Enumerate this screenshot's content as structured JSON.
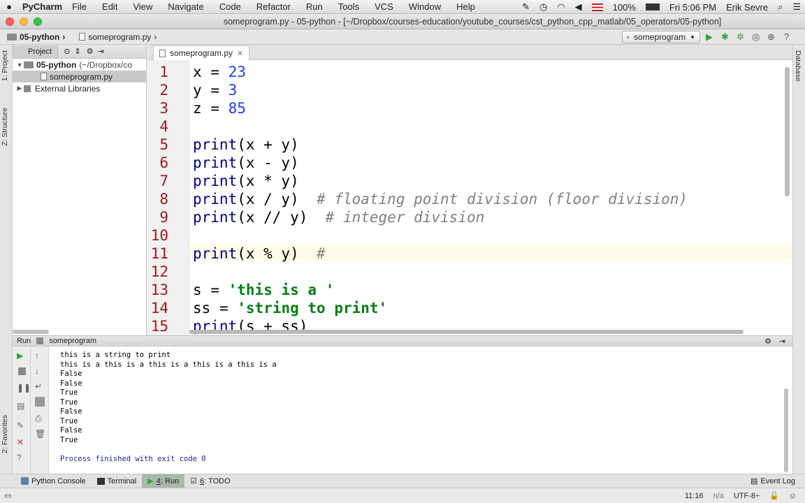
{
  "menubar": {
    "app_name": "PyCharm",
    "items": [
      "File",
      "Edit",
      "View",
      "Navigate",
      "Code",
      "Refactor",
      "Run",
      "Tools",
      "VCS",
      "Window",
      "Help"
    ],
    "battery": "100%",
    "clock": "Fri 5:06 PM",
    "user": "Erik Sevre"
  },
  "window": {
    "title": "someprogram.py - 05-python - [~/Dropbox/courses-education/youtube_courses/cst_python_cpp_matlab/05_operators/05-python]"
  },
  "navbar": {
    "crumbs": [
      "05-python",
      "someprogram.py"
    ],
    "run_config": "someprogram"
  },
  "left_strip": {
    "project_tab": "1: Project",
    "structure_tab": "Z: Structure",
    "favorites_tab": "2: Favorites"
  },
  "right_strip": {
    "database_tab": "Database"
  },
  "project_panel": {
    "header": "Project",
    "root": "05-python",
    "root_path": "(~/Dropbox/co",
    "file": "someprogram.py",
    "libraries": "External Libraries"
  },
  "editor": {
    "tab_label": "someprogram.py",
    "lines": [
      {
        "n": "1",
        "html": "<span class='id'>x</span> <span class='op'>=</span> <span class='num'>23</span>"
      },
      {
        "n": "2",
        "html": "<span class='id'>y</span> <span class='op'>=</span> <span class='num'>3</span>"
      },
      {
        "n": "3",
        "html": "<span class='id'>z</span> <span class='op'>=</span> <span class='num'>85</span>"
      },
      {
        "n": "4",
        "html": ""
      },
      {
        "n": "5",
        "html": "print<span class='op'>(x + y)</span>"
      },
      {
        "n": "6",
        "html": "print<span class='op'>(x - y)</span>"
      },
      {
        "n": "7",
        "html": "print<span class='op'>(x * y)</span>"
      },
      {
        "n": "8",
        "html": "print<span class='op'>(x / y)</span>  <span class='cm'># floating point division (floor division)</span>"
      },
      {
        "n": "9",
        "html": "print<span class='op'>(x // y)</span>  <span class='cm'># integer division</span>"
      },
      {
        "n": "10",
        "html": ""
      },
      {
        "n": "11",
        "html": "print<span class='op'>(x % y)</span>  <span class='cm'>#</span>"
      },
      {
        "n": "12",
        "html": ""
      },
      {
        "n": "13",
        "html": "<span class='id'>s</span> <span class='op'>=</span> <span class='str'>'this is a '</span>"
      },
      {
        "n": "14",
        "html": "<span class='id'>ss</span> <span class='op'>=</span> <span class='str'>'string to print'</span>"
      },
      {
        "n": "15",
        "html": "print<span class='op'>(s + ss)</span>"
      }
    ]
  },
  "run": {
    "label": "Run",
    "config": "someprogram",
    "output": [
      "this is a string to print",
      "this is a this is a this is a this is a this is a",
      "False",
      "False",
      "True",
      "True",
      "False",
      "True",
      "False",
      "True",
      "",
      "Process finished with exit code 0"
    ]
  },
  "bottom_tabs": {
    "python_console": "Python Console",
    "terminal": "Terminal",
    "run_num": "4",
    "run": ": Run",
    "todo_num": "6",
    "todo": ": TODO",
    "event_log": "Event Log"
  },
  "status": {
    "position": "11:16",
    "na": "n/a",
    "encoding": "UTF-8÷"
  }
}
